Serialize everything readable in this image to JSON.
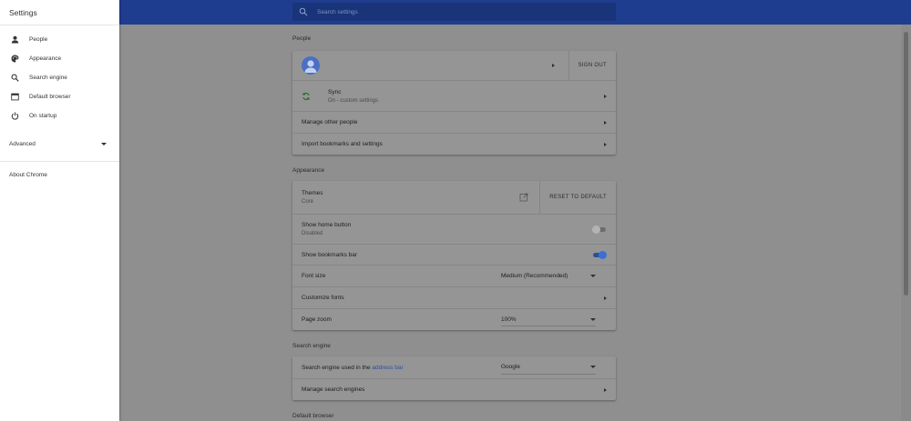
{
  "app": {
    "title": "Settings"
  },
  "search": {
    "placeholder": "Search settings"
  },
  "sidebar": {
    "items": [
      {
        "label": "People",
        "icon": "person-icon"
      },
      {
        "label": "Appearance",
        "icon": "palette-icon"
      },
      {
        "label": "Search engine",
        "icon": "search-icon"
      },
      {
        "label": "Default browser",
        "icon": "browser-icon"
      },
      {
        "label": "On startup",
        "icon": "power-icon"
      }
    ],
    "advanced_label": "Advanced",
    "about_label": "About Chrome"
  },
  "people": {
    "section_title": "People",
    "sign_out_label": "SIGN OUT",
    "sync_title": "Sync",
    "sync_status": "On - custom settings",
    "manage_other_people": "Manage other people",
    "import_bookmarks": "Import bookmarks and settings"
  },
  "appearance": {
    "section_title": "Appearance",
    "themes_label": "Themes",
    "themes_value": "Core",
    "reset_label": "RESET TO DEFAULT",
    "home_button_label": "Show home button",
    "home_button_status": "Disabled",
    "home_button_on": false,
    "bookmarks_bar_label": "Show bookmarks bar",
    "bookmarks_bar_on": true,
    "font_size_label": "Font size",
    "font_size_value": "Medium (Recommended)",
    "customize_fonts_label": "Customize fonts",
    "page_zoom_label": "Page zoom",
    "page_zoom_value": "100%"
  },
  "search_engine": {
    "section_title": "Search engine",
    "used_label_prefix": "Search engine used in the",
    "address_bar_link": "address bar",
    "engine_value": "Google",
    "manage_label": "Manage search engines"
  },
  "default_browser": {
    "section_title": "Default browser"
  },
  "colors": {
    "toolbar": "#1f3d8f",
    "accent": "#3b6fd6",
    "link": "#2c4fa6"
  }
}
